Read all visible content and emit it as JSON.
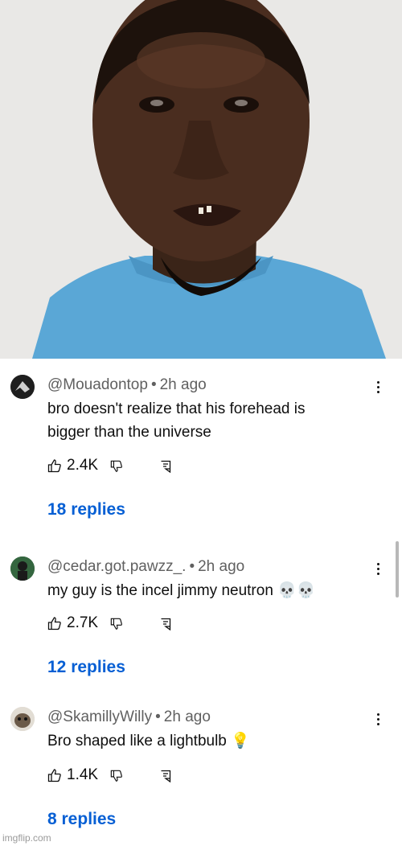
{
  "comments": [
    {
      "author": "@Mouadontop",
      "separator": "•",
      "time": "2h ago",
      "text_lines": [
        "bro doesn't realize that his forehead is",
        "bigger than the universe"
      ],
      "likes": "2.4K",
      "replies": "18 replies"
    },
    {
      "author": "@cedar.got.pawzz_.",
      "separator": "•",
      "time": "2h ago",
      "text_lines": [
        "my guy is the incel jimmy neutron 💀💀"
      ],
      "likes": "2.7K",
      "replies": "12 replies"
    },
    {
      "author": "@SkamillyWilly",
      "separator": "•",
      "time": "2h ago",
      "text_lines": [
        "Bro shaped like a lightbulb 💡"
      ],
      "likes": "1.4K",
      "replies": "8 replies"
    }
  ],
  "watermark": "imgflip.com",
  "colors": {
    "link": "#065fd4",
    "meta": "#606060",
    "shirt": "#5aa7d6"
  }
}
